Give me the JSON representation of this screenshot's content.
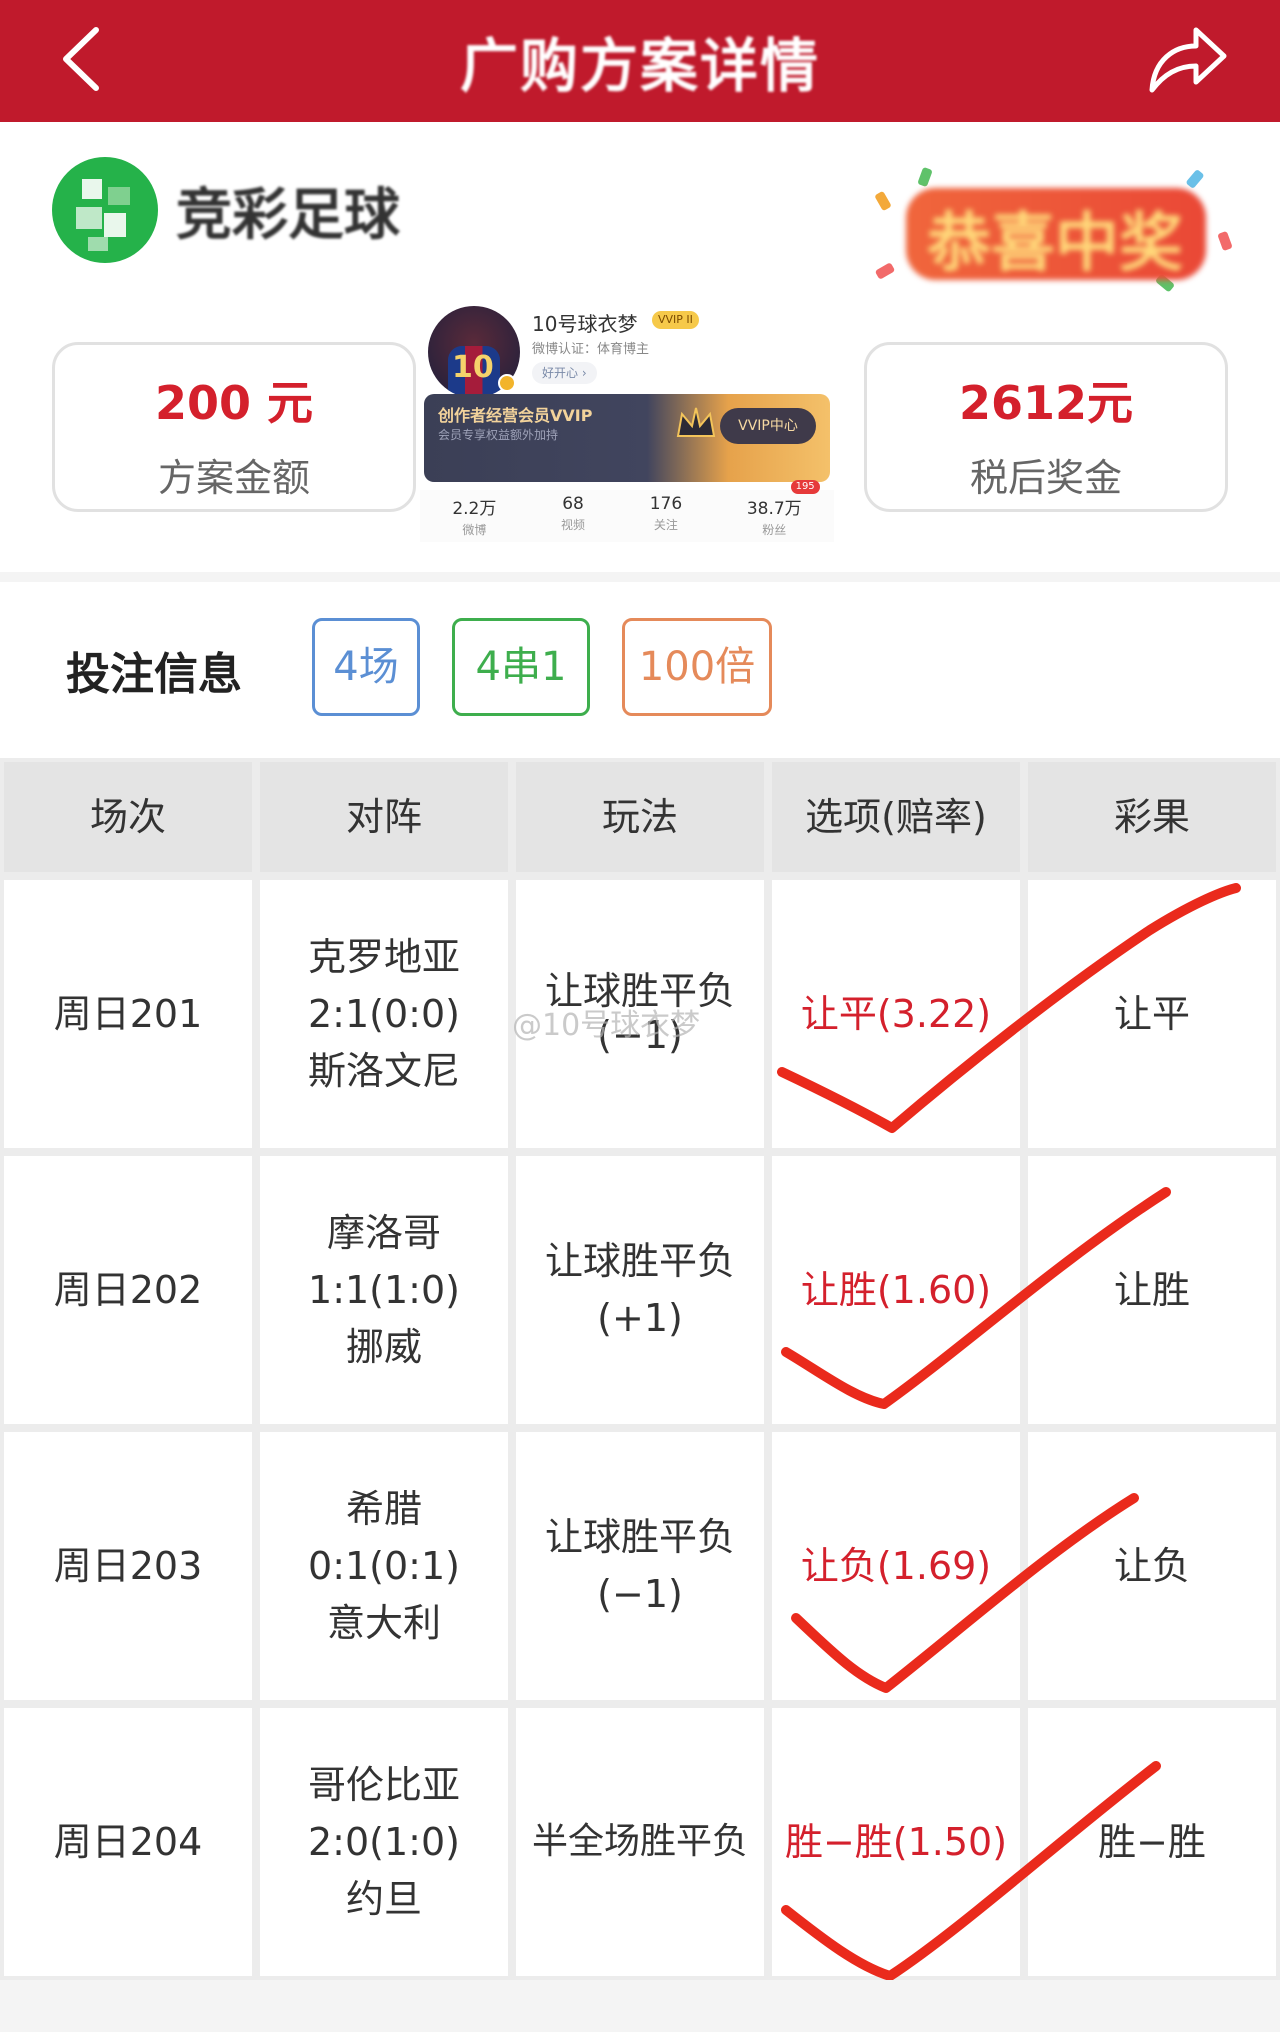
{
  "header": {
    "title": "广购方案详情",
    "back_icon": "chevron-left-icon",
    "share_icon": "share-arrow-icon",
    "bg_color": "#c01a2c"
  },
  "brand": {
    "name": "竞彩足球",
    "badge_text": "恭喜中奖"
  },
  "amount": {
    "value": "200 元",
    "label": "方案金额"
  },
  "prize": {
    "value": "2612元",
    "label": "税后奖金"
  },
  "profile": {
    "name": "10号球衣梦",
    "vip_tag": "VVIP II",
    "cert": "微博认证：体育博主",
    "happy": "好开心 ›",
    "banner_title": "创作者经营会员VVIP",
    "banner_sub": "会员专享权益额外加持",
    "banner_btn": "VVIP中心",
    "shirt_number": "10",
    "stats": [
      {
        "num": "2.2万",
        "label": "微博"
      },
      {
        "num": "68",
        "label": "视频"
      },
      {
        "num": "176",
        "label": "关注"
      },
      {
        "num": "38.7万",
        "label": "粉丝",
        "badge": "195"
      }
    ]
  },
  "bet_info": {
    "heading": "投注信息",
    "chips": [
      {
        "label": "4场",
        "color": "#5b8fd4"
      },
      {
        "label": "4串1",
        "color": "#3eae4d"
      },
      {
        "label": "100倍",
        "color": "#e58a5a"
      }
    ]
  },
  "table": {
    "headers": [
      "场次",
      "对阵",
      "玩法",
      "选项(赔率)",
      "彩果"
    ],
    "rows": [
      {
        "session": "周日201",
        "home": "克罗地亚",
        "score": "2:1(0:0)",
        "away": "斯洛文尼",
        "play1": "让球胜平负",
        "play2": "(−1)",
        "option": "让平(3.22)",
        "result": "让平"
      },
      {
        "session": "周日202",
        "home": "摩洛哥",
        "score": "1:1(1:0)",
        "away": "挪威",
        "play1": "让球胜平负",
        "play2": "(+1)",
        "option": "让胜(1.60)",
        "result": "让胜"
      },
      {
        "session": "周日203",
        "home": "希腊",
        "score": "0:1(0:1)",
        "away": "意大利",
        "play1": "让球胜平负",
        "play2": "(−1)",
        "option": "让负(1.69)",
        "result": "让负"
      },
      {
        "session": "周日204",
        "home": "哥伦比亚",
        "score": "2:0(1:0)",
        "away": "约旦",
        "play1": "半全场胜平负",
        "play2": "",
        "option": "胜−胜(1.50)",
        "result": "胜−胜"
      }
    ],
    "watermark": "@10号球衣梦",
    "accent_color": "#d4202c"
  }
}
